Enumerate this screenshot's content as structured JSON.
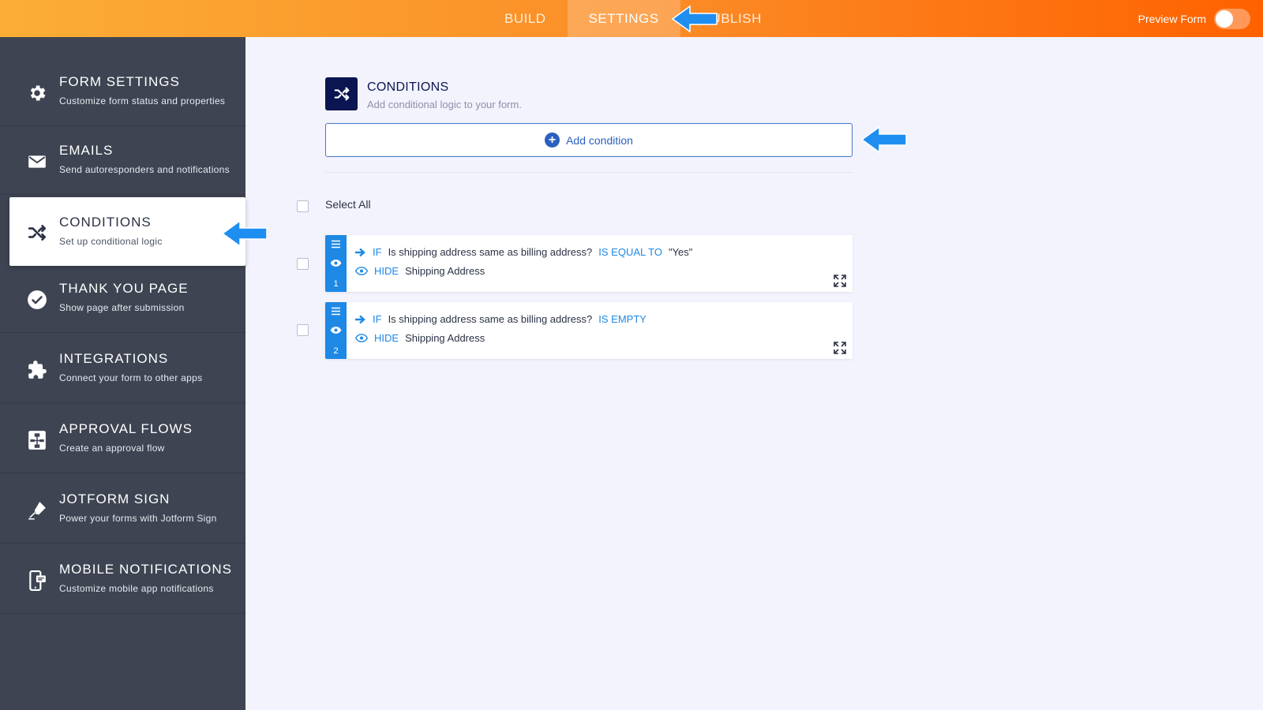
{
  "topbar": {
    "tabs": [
      {
        "label": "BUILD",
        "active": false
      },
      {
        "label": "SETTINGS",
        "active": true
      },
      {
        "label": "PUBLISH",
        "active": false
      }
    ],
    "preview_label": "Preview Form",
    "preview_on": false
  },
  "sidebar": {
    "items": [
      {
        "title": "FORM SETTINGS",
        "subtitle": "Customize form status and properties",
        "icon": "gear-icon"
      },
      {
        "title": "EMAILS",
        "subtitle": "Send autoresponders and notifications",
        "icon": "envelope-icon"
      },
      {
        "title": "CONDITIONS",
        "subtitle": "Set up conditional logic",
        "icon": "shuffle-icon",
        "active": true
      },
      {
        "title": "THANK YOU PAGE",
        "subtitle": "Show page after submission",
        "icon": "check-circle-icon"
      },
      {
        "title": "INTEGRATIONS",
        "subtitle": "Connect your form to other apps",
        "icon": "puzzle-icon"
      },
      {
        "title": "APPROVAL FLOWS",
        "subtitle": "Create an approval flow",
        "icon": "flow-icon"
      },
      {
        "title": "JOTFORM SIGN",
        "subtitle": "Power your forms with Jotform Sign",
        "icon": "pen-icon"
      },
      {
        "title": "MOBILE NOTIFICATIONS",
        "subtitle": "Customize mobile app notifications",
        "icon": "mobile-icon"
      }
    ]
  },
  "main": {
    "title": "CONDITIONS",
    "subtitle": "Add conditional logic to your form.",
    "add_button": "Add condition",
    "select_all": "Select All",
    "conditions": [
      {
        "number": "1",
        "if_kw": "IF",
        "field": "Is shipping address same as billing address?",
        "operator": "IS EQUAL TO",
        "value": "\"Yes\"",
        "action_kw": "HIDE",
        "target": "Shipping Address"
      },
      {
        "number": "2",
        "if_kw": "IF",
        "field": "Is shipping address same as billing address?",
        "operator": "IS EMPTY",
        "value": "",
        "action_kw": "HIDE",
        "target": "Shipping Address"
      }
    ]
  },
  "colors": {
    "accent": "#1e88e5",
    "navy": "#0a1551",
    "sidebar": "#3e4452",
    "callout_arrow": "#1e8ff0"
  }
}
